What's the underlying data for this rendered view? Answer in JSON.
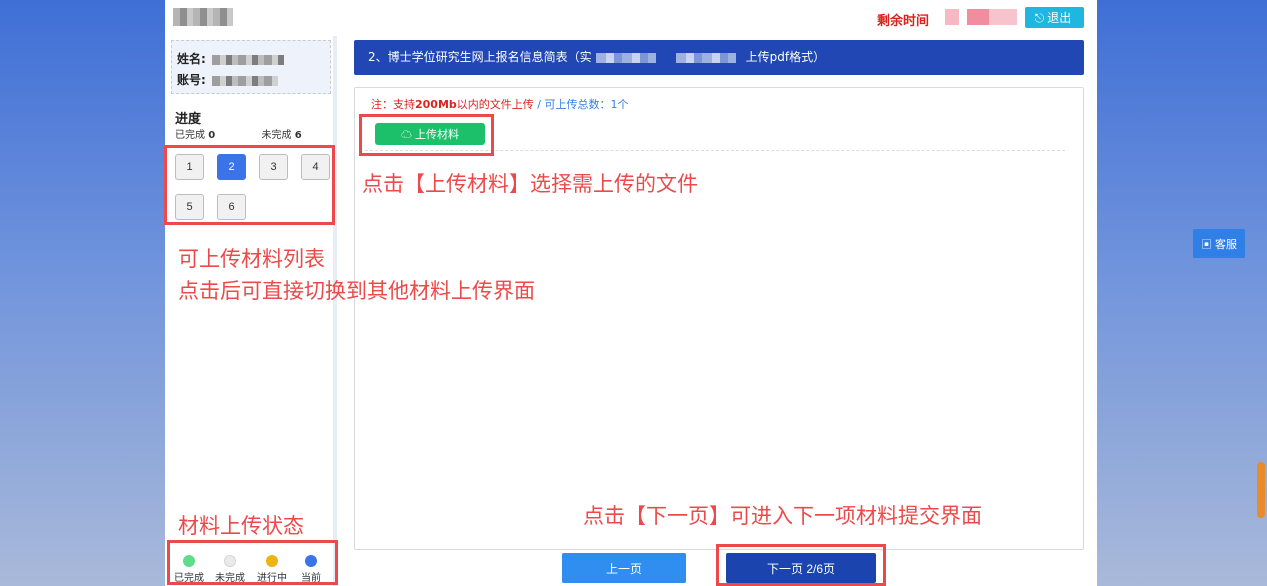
{
  "header": {
    "timer_label": "剩余时间",
    "exit_icon": "logout-icon",
    "exit_label": "退出"
  },
  "sidebar": {
    "name_label": "姓名:",
    "account_label": "账号:",
    "progress_title": "进度",
    "completed_label": "已完成",
    "completed_count": "0",
    "pending_label": "未完成",
    "pending_count": "6",
    "items": [
      "1",
      "2",
      "3",
      "4",
      "5",
      "6"
    ],
    "current_item": "2",
    "legend": [
      {
        "label": "已完成",
        "color": "#5fdc8a"
      },
      {
        "label": "未完成",
        "color": "#eaeaea"
      },
      {
        "label": "进行中",
        "color": "#ebb313"
      },
      {
        "label": "当前",
        "color": "#3b74e8"
      }
    ]
  },
  "main": {
    "title_prefix": "2、博士学位研究生网上报名信息简表（实",
    "title_suffix": "上传pdf格式）",
    "note_prefix": "注：支持",
    "note_size": "200Mb",
    "note_mid": "以内的文件上传",
    "note_count": " / 可上传总数：1个",
    "upload_icon": "cloud-upload-icon",
    "upload_label": "上传材料"
  },
  "nav": {
    "prev_label": "上一页",
    "next_label": "下一页 2/6页"
  },
  "annotations": {
    "upload_hint": "点击【上传材料】选择需上传的文件",
    "list_hint_line1": "可上传材料列表",
    "list_hint_line2": "点击后可直接切换到其他材料上传界面",
    "status_hint": "材料上传状态",
    "next_hint": "点击【下一页】可进入下一项材料提交界面"
  },
  "service": {
    "icon": "chat-icon",
    "label": "客服"
  },
  "colors": {
    "accent_blue": "#2047b4",
    "annotation_red": "#ec4a4a",
    "upload_green": "#1cc06b",
    "exit_cyan": "#1fb6e0"
  }
}
